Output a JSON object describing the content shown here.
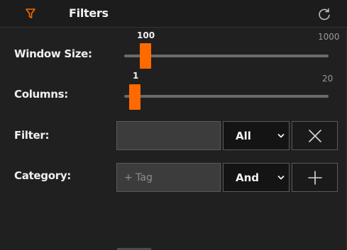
{
  "header": {
    "title": "Filters",
    "filter_icon": "filter-icon",
    "refresh_icon": "refresh-icon",
    "accent_color": "#ff6a00"
  },
  "window_size": {
    "label": "Window Size:",
    "value": "100",
    "max": "1000"
  },
  "columns": {
    "label": "Columns:",
    "value": "1",
    "max": "20"
  },
  "filter": {
    "label": "Filter:",
    "input_value": "",
    "input_placeholder": "",
    "mode": "All",
    "clear_icon": "close-icon"
  },
  "category": {
    "label": "Category:",
    "input_value": "",
    "input_placeholder": "+ Tag",
    "mode": "And",
    "add_icon": "plus-icon"
  }
}
